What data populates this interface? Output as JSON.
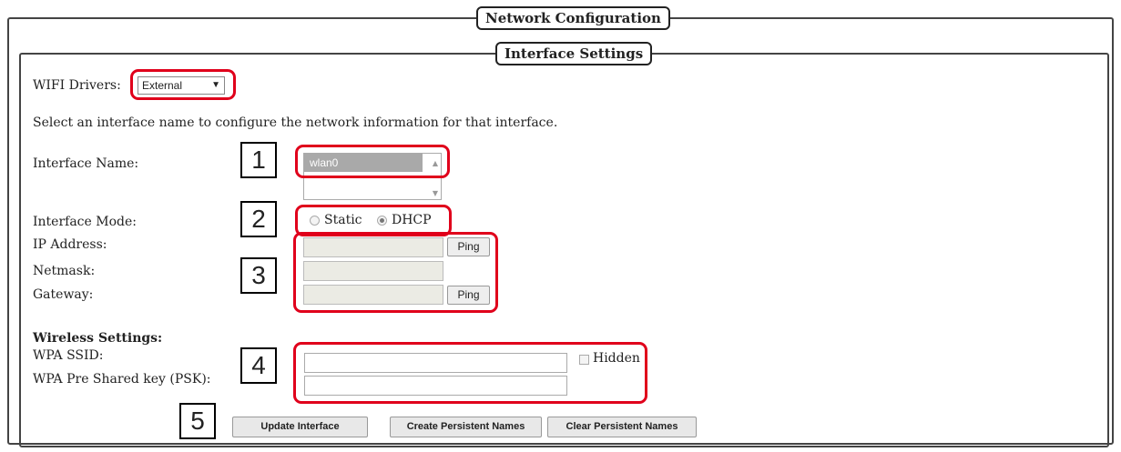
{
  "network_config": {
    "legend": "Network Configuration"
  },
  "interface_settings": {
    "legend": "Interface Settings"
  },
  "wifi": {
    "label": "WIFI Drivers:",
    "selected": "External"
  },
  "intro_text": "Select an interface name to configure the network information for that interface.",
  "interface_name": {
    "label": "Interface Name:",
    "options": [
      "wlan0"
    ],
    "selected": "wlan0"
  },
  "interface_mode": {
    "label": "Interface Mode:",
    "options": [
      "Static",
      "DHCP"
    ],
    "selected": "DHCP"
  },
  "ip": {
    "label": "IP Address:",
    "ping_label": "Ping"
  },
  "netmask": {
    "label": "Netmask:"
  },
  "gateway": {
    "label": "Gateway:",
    "ping_label": "Ping"
  },
  "wireless": {
    "heading": "Wireless Settings:",
    "ssid_label": "WPA SSID:",
    "hidden_label": "Hidden",
    "psk_label": "WPA Pre Shared key (PSK):"
  },
  "buttons": {
    "update": "Update Interface",
    "create": "Create Persistent Names",
    "clear": "Clear Persistent Names"
  },
  "annotations": [
    "1",
    "2",
    "3",
    "4",
    "5"
  ],
  "colors": {
    "highlight": "#e0001b",
    "disabled_field": "#ebebe4"
  }
}
